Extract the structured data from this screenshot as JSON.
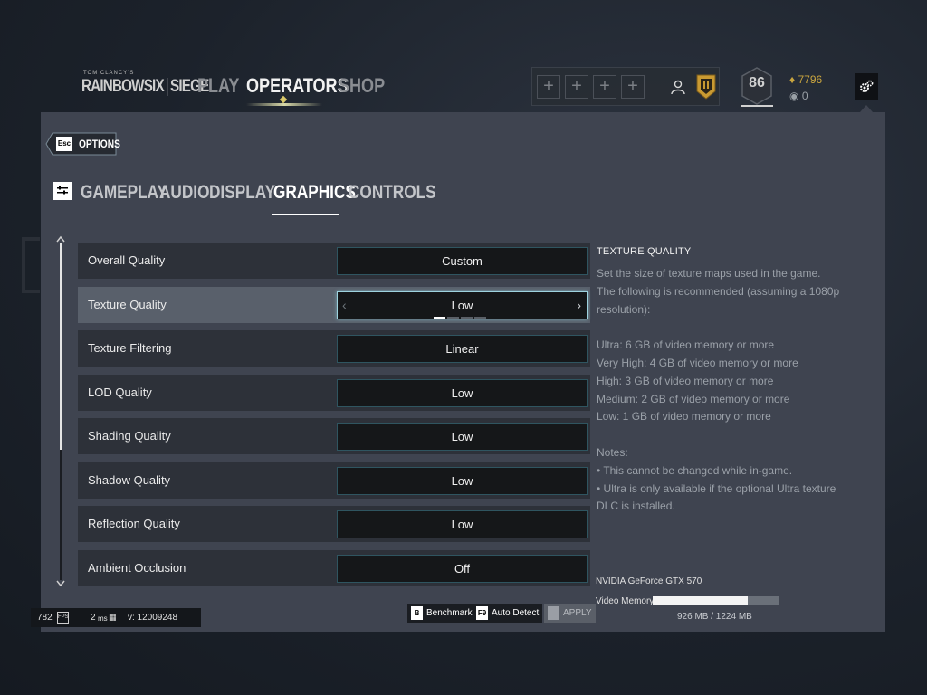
{
  "nav": {
    "logo_small": "TOM CLANCY'S",
    "logo_left": "RAINBOWSIX",
    "logo_right": "SIEGE",
    "items": [
      {
        "label": "PLAY",
        "active": false
      },
      {
        "label": "OPERATORS",
        "active": true
      },
      {
        "label": "SHOP",
        "active": false
      }
    ]
  },
  "squad": {
    "slot_symbol": "+",
    "icons": [
      "profile-icon",
      "rank-badge-icon"
    ]
  },
  "player": {
    "level": "86",
    "renown": "7796",
    "credits": "0"
  },
  "options": {
    "back_key": "Esc",
    "back_label": "OPTIONS",
    "tabs": [
      {
        "label": "GAMEPLAY",
        "active": false
      },
      {
        "label": "AUDIO",
        "active": false
      },
      {
        "label": "DISPLAY",
        "active": false
      },
      {
        "label": "GRAPHICS",
        "active": true
      },
      {
        "label": "CONTROLS",
        "active": false
      }
    ]
  },
  "settings": [
    {
      "label": "Overall Quality",
      "value": "Custom",
      "selected": false
    },
    {
      "label": "Texture Quality",
      "value": "Low",
      "selected": true,
      "option_index": 0,
      "option_count": 4
    },
    {
      "label": "Texture Filtering",
      "value": "Linear",
      "selected": false
    },
    {
      "label": "LOD Quality",
      "value": "Low",
      "selected": false
    },
    {
      "label": "Shading Quality",
      "value": "Low",
      "selected": false
    },
    {
      "label": "Shadow Quality",
      "value": "Low",
      "selected": false
    },
    {
      "label": "Reflection Quality",
      "value": "Low",
      "selected": false
    },
    {
      "label": "Ambient Occlusion",
      "value": "Off",
      "selected": false
    }
  ],
  "arrows": {
    "left": "‹",
    "right": "›"
  },
  "description": {
    "title": "TEXTURE QUALITY",
    "intro": "Set the size of texture maps used in the game. The following is recommended (assuming a 1080p resolution):",
    "recommendations": [
      "Ultra: 6 GB of video memory or more",
      "Very High: 4 GB of video memory or more",
      "High: 3 GB of video memory or more",
      "Medium: 2 GB of video memory or more",
      "Low: 1 GB of video memory or more"
    ],
    "notes_title": "Notes:",
    "notes": [
      "• This cannot be changed while in-game.",
      "• Ultra is only available if the optional Ultra texture DLC is installed."
    ]
  },
  "gpu": {
    "name": "NVIDIA GeForce GTX 570",
    "memory_label": "Video Memory:",
    "memory_text": "926 MB / 1224 MB",
    "used_mb": 926,
    "total_mb": 1224
  },
  "buttons": [
    {
      "key": "B",
      "label": "Benchmark",
      "enabled": true
    },
    {
      "key": "F9",
      "label": "Auto Detect",
      "enabled": true
    },
    {
      "key": "",
      "label": "APPLY",
      "enabled": false
    }
  ],
  "stats": {
    "fps": "782",
    "fps_unit": "FPS",
    "ping": "2",
    "ping_unit": "ms",
    "version": "v: 12009248"
  },
  "colors": {
    "panel": "#3f4450",
    "row": "#2d3139",
    "row_selected": "#59606b",
    "value_border": "#2f5560",
    "renown": "#c9a53f"
  }
}
